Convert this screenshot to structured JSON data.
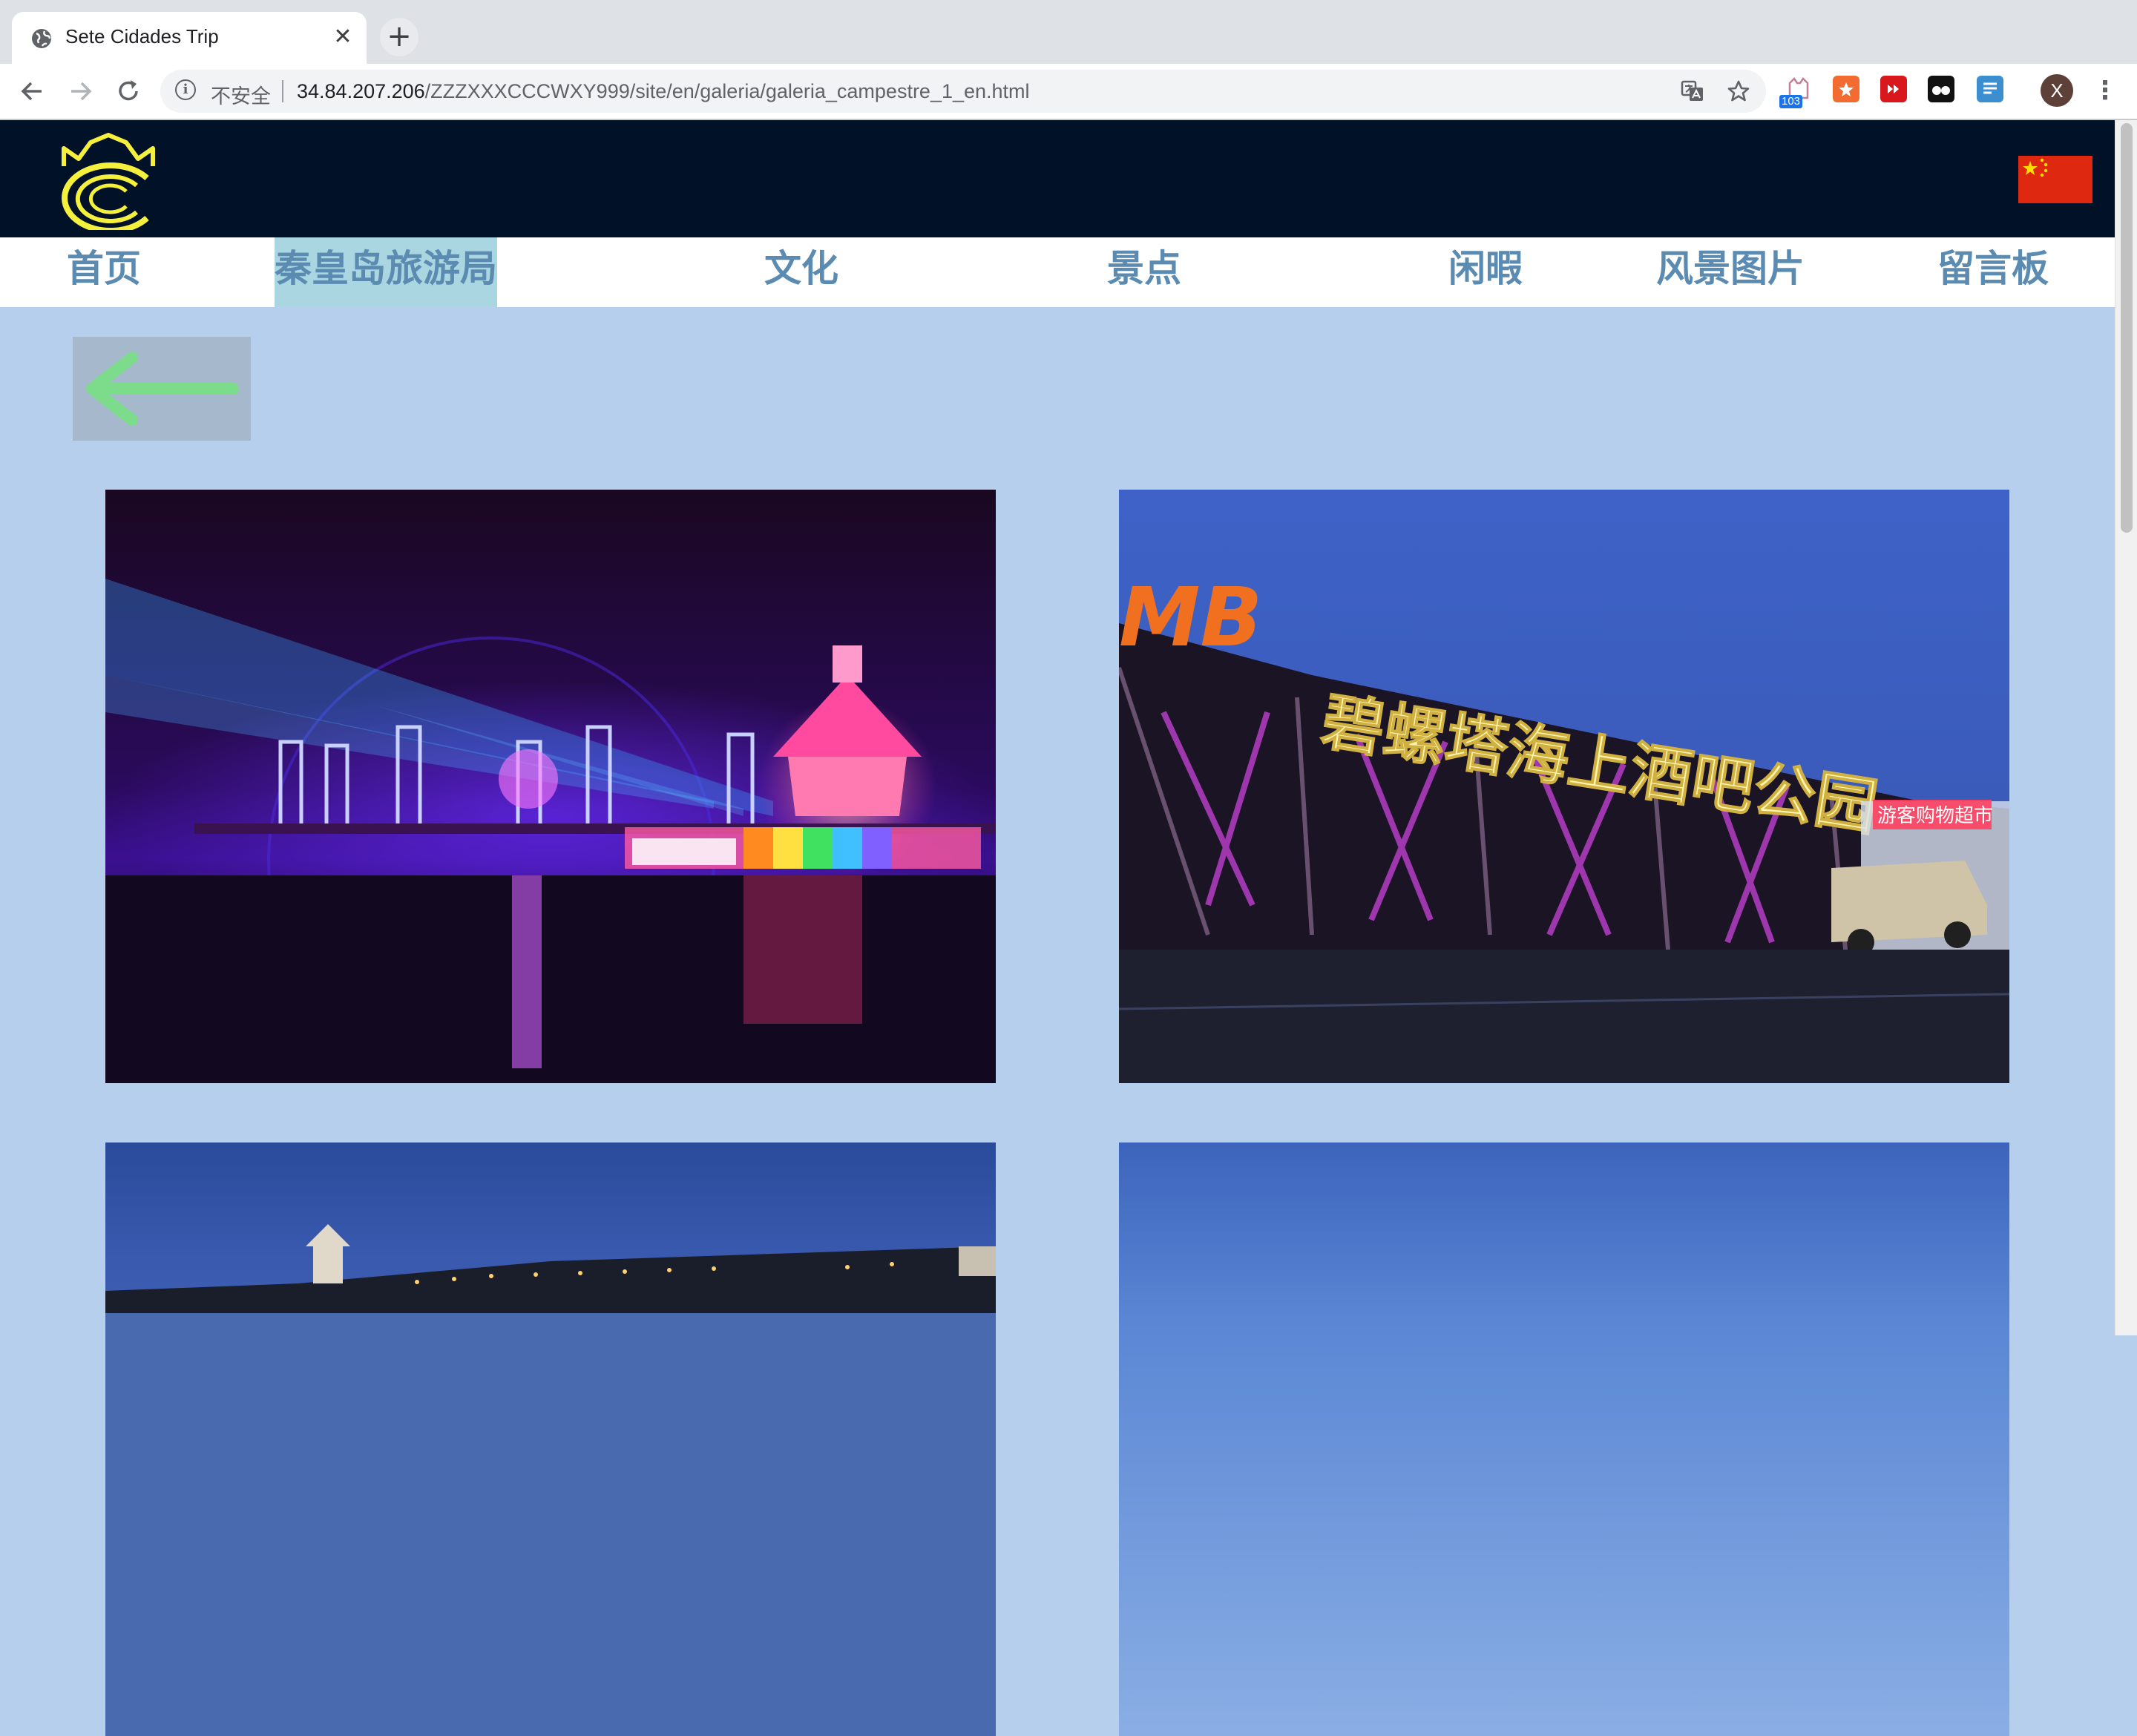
{
  "browser": {
    "tab_title": "Sete Cidades Trip",
    "close_glyph": "✕",
    "newtab_glyph": "+",
    "security_label": "不安全",
    "url_host": "34.84.207.206",
    "url_path": "/ZZZXXXCCCWXY999/site/en/galeria/galeria_campestre_1_en.html",
    "extension_badge": "103",
    "profile_initial": "X",
    "icons": [
      "globe-icon",
      "back-arrow-icon",
      "forward-arrow-icon",
      "reload-icon",
      "info-icon",
      "translate-icon",
      "star-icon",
      "extension-icon",
      "kebab-menu-icon"
    ]
  },
  "site": {
    "nav": [
      "首页",
      "秦皇岛旅游局",
      "文化",
      "景点",
      "闲暇",
      "风景图片",
      "留言板"
    ],
    "active_nav": "秦皇岛旅游局",
    "colors": {
      "header_bg": "#001128",
      "page_bg": "#b6cfed",
      "nav_text": "#5b8bb0",
      "nav_active_bg": "#a9d6e0",
      "back_arrow": "#7ddc8c",
      "logo": "#f5f03c"
    }
  },
  "gallery": {
    "photo_2_sign": "碧螺塔海上酒吧公园",
    "photo_2_shop": "游客购物超市",
    "photos": [
      "night-pier-light-show-photo",
      "bar-park-entrance-sign-photo",
      "coastal-pagoda-dusk-photo",
      "blue-sky-photo"
    ]
  }
}
